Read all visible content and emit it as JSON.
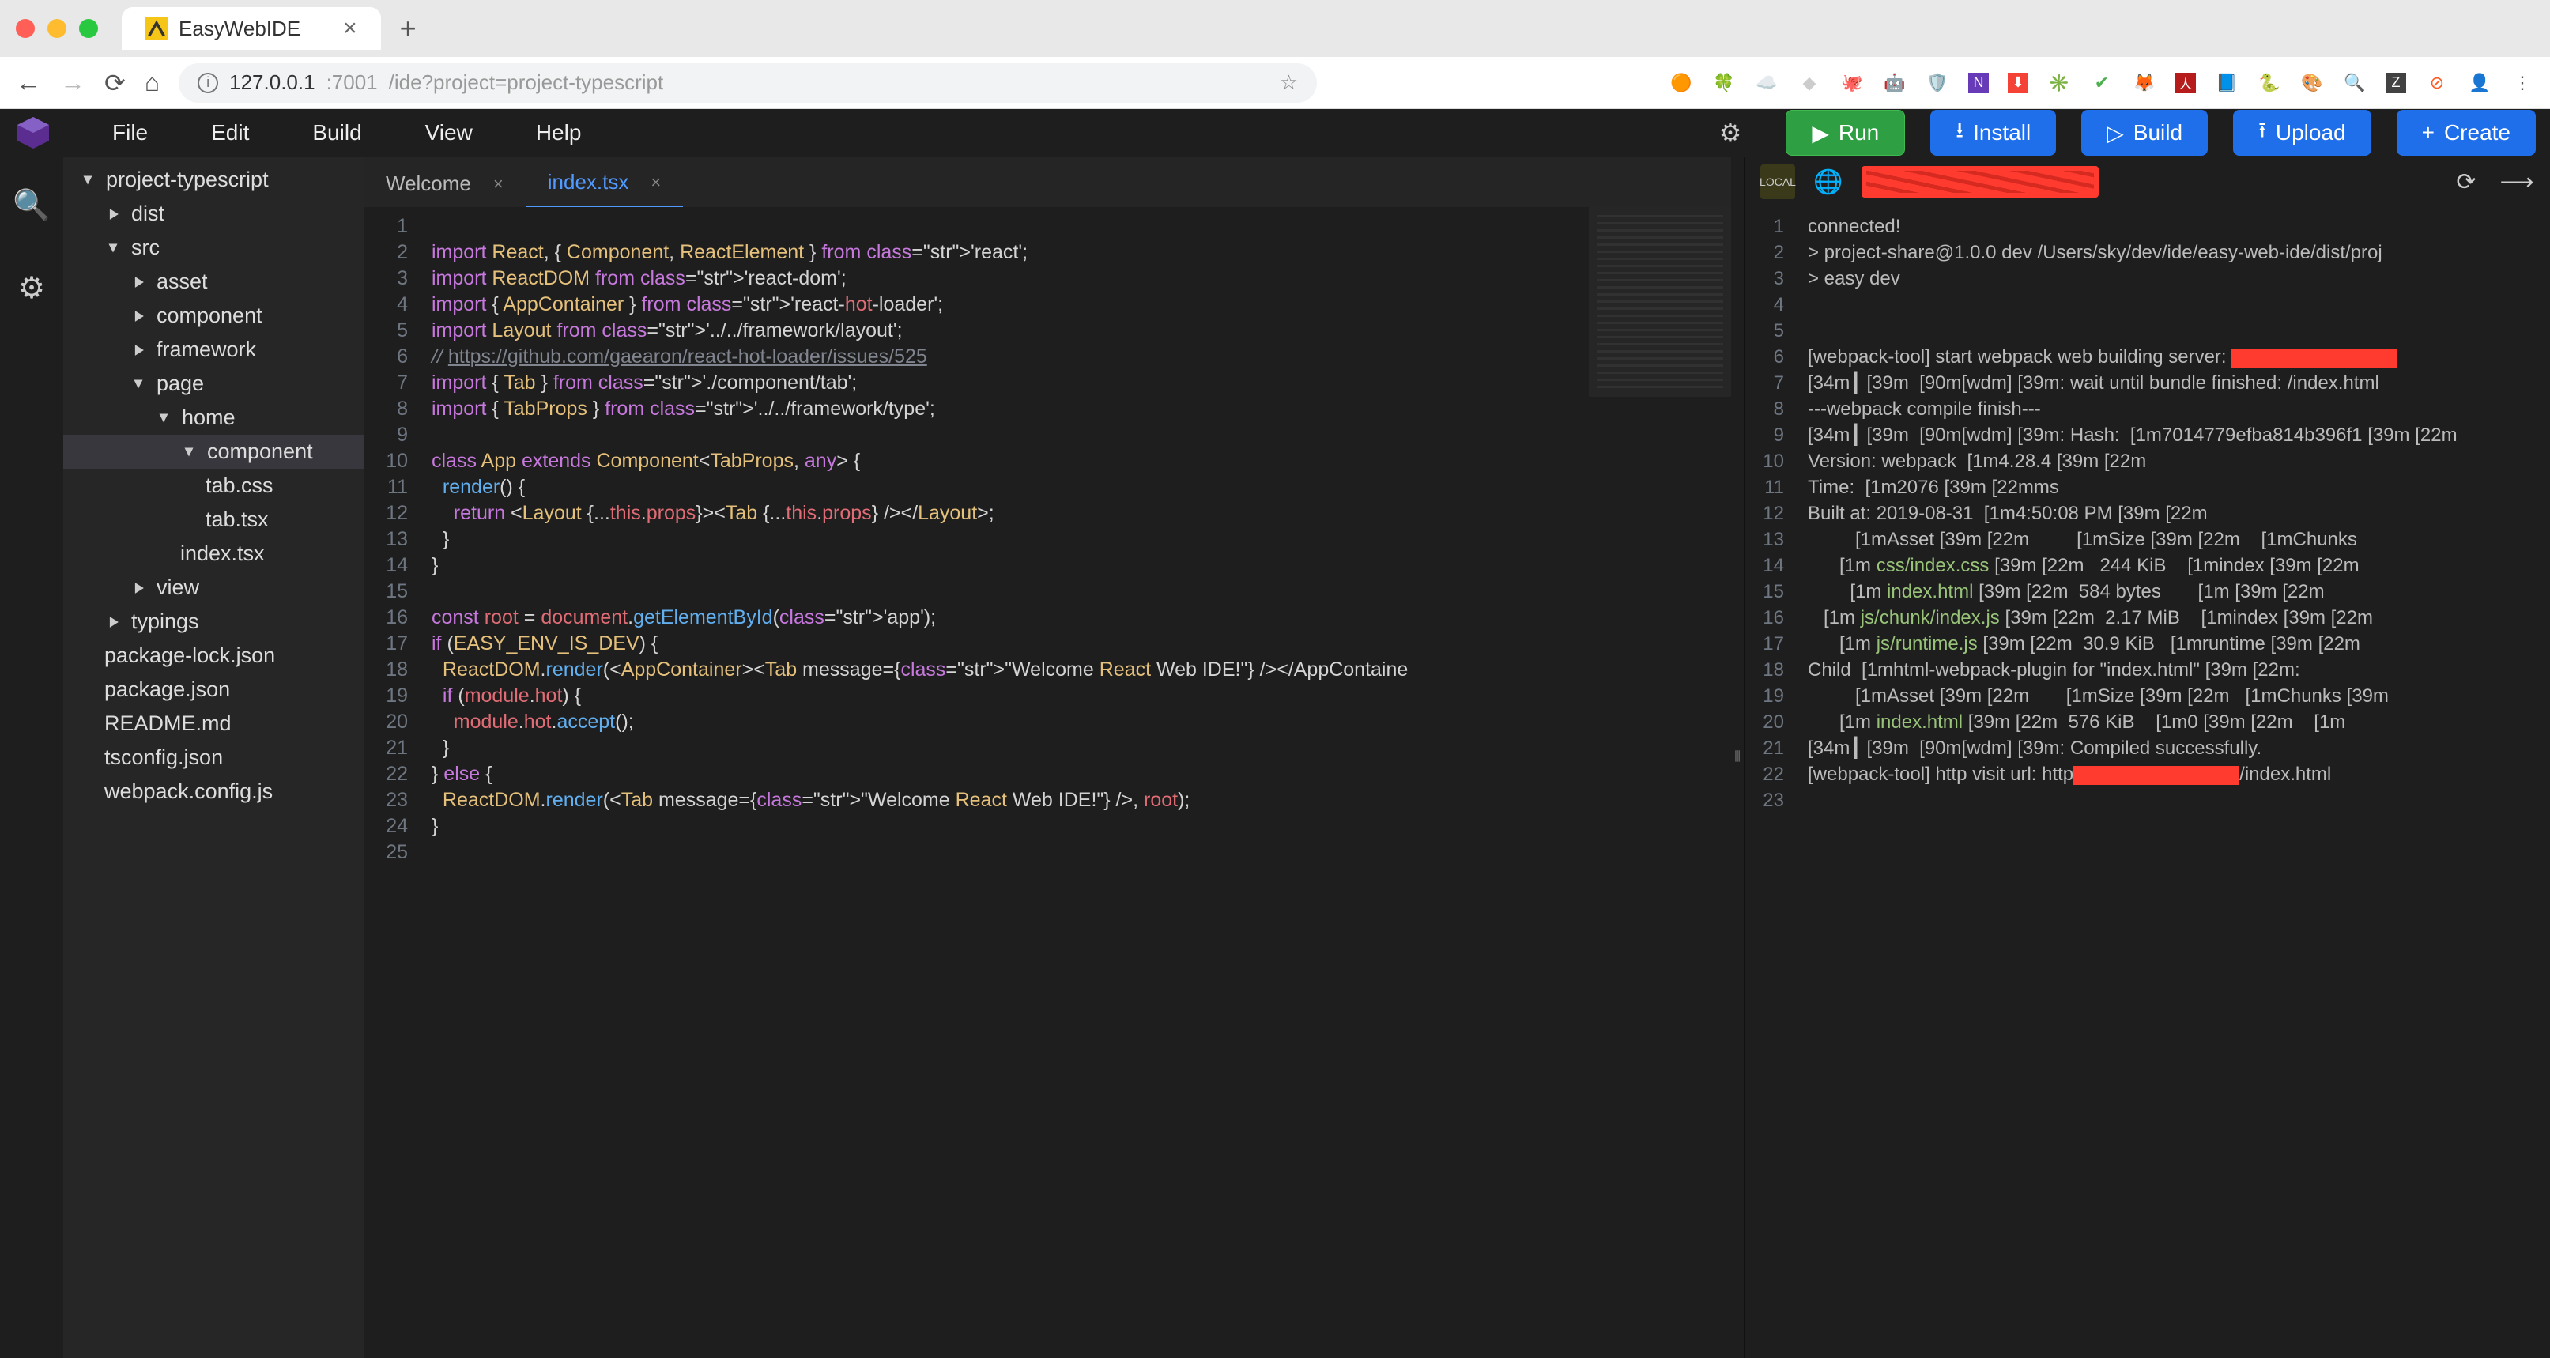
{
  "browser": {
    "tab_title": "EasyWebIDE",
    "url_host": "127.0.0.1",
    "url_port": ":7001",
    "url_path": "/ide?project=project-typescript"
  },
  "menu": {
    "items": [
      "File",
      "Edit",
      "Build",
      "View",
      "Help"
    ]
  },
  "actions": {
    "run": "Run",
    "install": "Install",
    "build": "Build",
    "upload": "Upload",
    "create": "Create"
  },
  "explorer": {
    "nodes": [
      {
        "label": "project-typescript",
        "depth": 0,
        "kind": "folder-open"
      },
      {
        "label": "dist",
        "depth": 1,
        "kind": "folder"
      },
      {
        "label": "src",
        "depth": 1,
        "kind": "folder-open"
      },
      {
        "label": "asset",
        "depth": 2,
        "kind": "folder"
      },
      {
        "label": "component",
        "depth": 2,
        "kind": "folder"
      },
      {
        "label": "framework",
        "depth": 2,
        "kind": "folder"
      },
      {
        "label": "page",
        "depth": 2,
        "kind": "folder-open"
      },
      {
        "label": "home",
        "depth": 3,
        "kind": "folder-open"
      },
      {
        "label": "component",
        "depth": 4,
        "kind": "folder-open",
        "selected": true
      },
      {
        "label": "tab.css",
        "depth": 5,
        "kind": "file"
      },
      {
        "label": "tab.tsx",
        "depth": 5,
        "kind": "file"
      },
      {
        "label": "index.tsx",
        "depth": 4,
        "kind": "file"
      },
      {
        "label": "view",
        "depth": 2,
        "kind": "folder"
      },
      {
        "label": "typings",
        "depth": 1,
        "kind": "folder"
      },
      {
        "label": "package-lock.json",
        "depth": 1,
        "kind": "file"
      },
      {
        "label": "package.json",
        "depth": 1,
        "kind": "file"
      },
      {
        "label": "README.md",
        "depth": 1,
        "kind": "file"
      },
      {
        "label": "tsconfig.json",
        "depth": 1,
        "kind": "file"
      },
      {
        "label": "webpack.config.js",
        "depth": 1,
        "kind": "file"
      }
    ]
  },
  "editor": {
    "tabs": [
      {
        "label": "Welcome",
        "active": false
      },
      {
        "label": "index.tsx",
        "active": true
      }
    ],
    "line_count": 25,
    "code_lines": [
      "",
      "import React, { Component, ReactElement } from 'react';",
      "import ReactDOM from 'react-dom';",
      "import { AppContainer } from 'react-hot-loader';",
      "import Layout from '../../framework/layout';",
      "// https://github.com/gaearon/react-hot-loader/issues/525",
      "import { Tab } from './component/tab';",
      "import { TabProps } from '../../framework/type';",
      "",
      "class App extends Component<TabProps, any> {",
      "  render() {",
      "    return <Layout {...this.props}><Tab {...this.props} /></Layout>;",
      "  }",
      "}",
      "",
      "const root = document.getElementById('app');",
      "if (EASY_ENV_IS_DEV) {",
      "  ReactDOM.render(<AppContainer><Tab message={\"Welcome React Web IDE!\"} /></AppContaine",
      "  if (module.hot) {",
      "    module.hot.accept();",
      "  }",
      "} else {",
      "  ReactDOM.render(<Tab message={\"Welcome React Web IDE!\"} />, root);",
      "}",
      ""
    ]
  },
  "terminal": {
    "line_count": 23,
    "lines": [
      "connected!",
      "> project-share@1.0.0 dev /Users/sky/dev/ide/easy-web-ide/dist/proj",
      "> easy dev",
      "",
      "",
      "[webpack-tool] start webpack web building server: [REDACTED]",
      "[34m┃ [39m  [90m[wdm] [39m: wait until bundle finished: /index.html",
      "---webpack compile finish---",
      "[34m┃ [39m  [90m[wdm] [39m: Hash:  [1m7014779efba814b396f1 [39m [22m",
      "Version: webpack  [1m4.28.4 [39m [22m",
      "Time:  [1m2076 [39m [22mms",
      "Built at: 2019-08-31  [1m4:50:08 PM [39m [22m",
      "         [1mAsset [39m [22m         [1mSize [39m [22m    [1mChunks ",
      "      [1m [32mcss/index.css [39m [22m   244 KiB    [1mindex [39m [22m",
      "        [1m [32mindex.html [39m [22m  584 bytes       [1m [39m [22m",
      "   [1m [32mjs/chunk/index.js [39m [22m  2.17 MiB    [1mindex [39m [22m",
      "      [1m [32mjs/runtime.js [39m [22m  30.9 KiB   [1mruntime [39m [22m",
      "Child  [1mhtml-webpack-plugin for \"index.html\" [39m [22m:",
      "         [1mAsset [39m [22m       [1mSize [39m [22m   [1mChunks [39m ",
      "      [1m [32mindex.html [39m [22m  576 KiB    [1m0 [39m [22m    [1m",
      "[34m┃ [39m  [90m[wdm] [39m: Compiled successfully.",
      "[webpack-tool] http visit url: http[REDACTED]/index.html",
      ""
    ]
  }
}
